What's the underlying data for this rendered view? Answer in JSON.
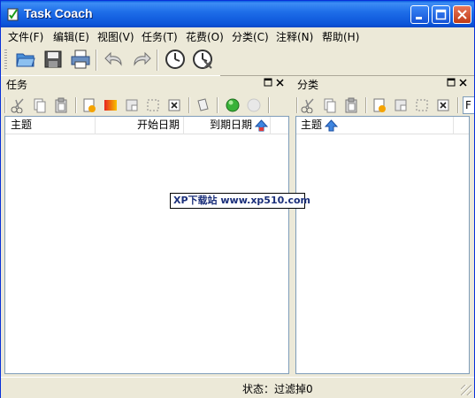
{
  "window": {
    "title": "Task Coach"
  },
  "menu": [
    "文件(F)",
    "编辑(E)",
    "视图(V)",
    "任务(T)",
    "花费(O)",
    "分类(C)",
    "注释(N)",
    "帮助(H)"
  ],
  "toolbar": {
    "tools": [
      {
        "icon": "open-folder-icon"
      },
      {
        "icon": "save-icon"
      },
      {
        "icon": "print-icon"
      },
      {
        "icon": "undo-icon"
      },
      {
        "icon": "redo-icon"
      },
      {
        "icon": "start-tracking-icon"
      },
      {
        "icon": "stop-tracking-icon"
      }
    ]
  },
  "tasks_pane": {
    "title": "任务",
    "columns": [
      {
        "label": "主题"
      },
      {
        "label": "开始日期"
      },
      {
        "label": "到期日期"
      }
    ],
    "sort_icon": "sort-ascending-icon"
  },
  "categories_pane": {
    "title": "分类",
    "columns": [
      {
        "label": "主题"
      }
    ],
    "sort_icon": "sort-ascending-icon",
    "truncated_tool": "F"
  },
  "status": {
    "text": "状态：过滤掉0"
  },
  "watermark": {
    "text": "XP下载站 www.xp510.com"
  },
  "colors": {
    "titlebar": "#0b54d9",
    "face": "#ece9d8",
    "accent": "#3d8df5"
  }
}
